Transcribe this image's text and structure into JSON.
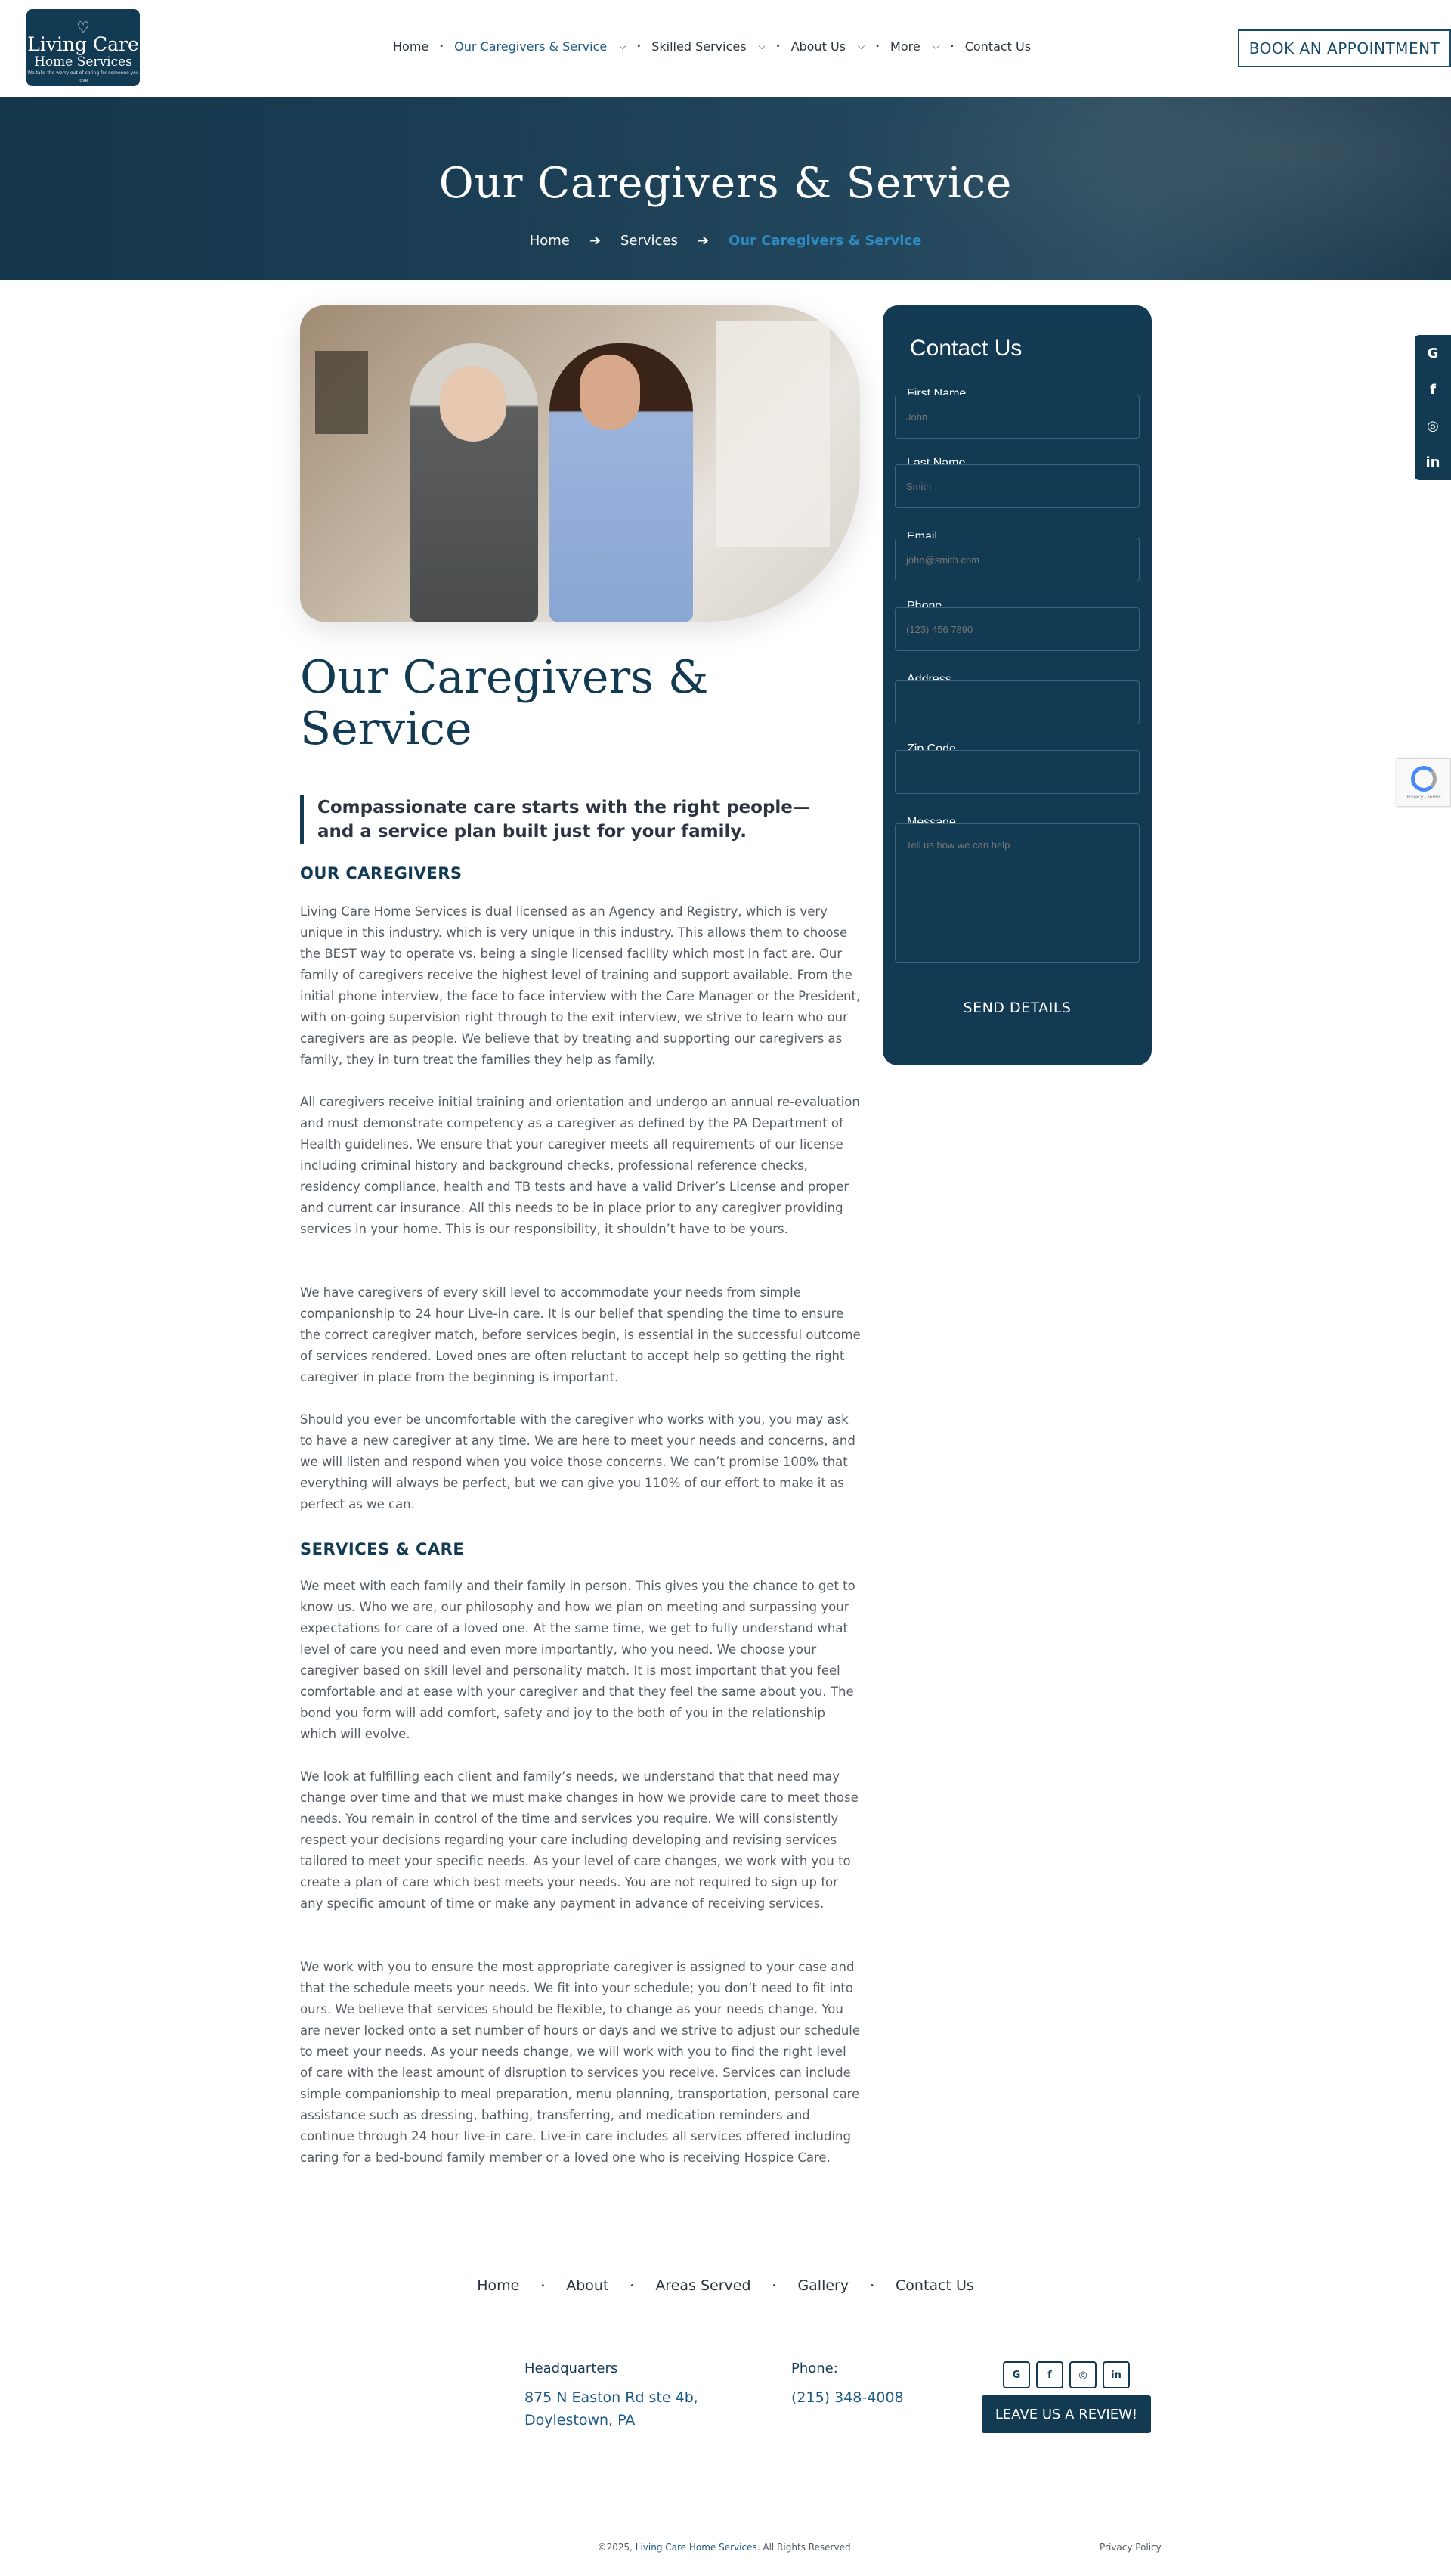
{
  "logo": {
    "line1": "Living Care",
    "line2": "Home Services",
    "tagline": "We take the worry out of caring for someone you love"
  },
  "nav": {
    "items": [
      {
        "label": "Home",
        "dropdown": false,
        "active": false
      },
      {
        "label": "Our Caregivers & Service",
        "dropdown": true,
        "active": true
      },
      {
        "label": "Skilled Services",
        "dropdown": true,
        "active": false
      },
      {
        "label": "About Us",
        "dropdown": true,
        "active": false
      },
      {
        "label": "More",
        "dropdown": true,
        "active": false
      },
      {
        "label": "Contact Us",
        "dropdown": false,
        "active": false
      }
    ],
    "book_label": "BOOK AN APPOINTMENT"
  },
  "hero": {
    "title": "Our Caregivers & Service",
    "breadcrumb": [
      "Home",
      "Services",
      "Our Caregivers & Service"
    ]
  },
  "article": {
    "title": "Our Caregivers & Service",
    "quote": "Compassionate care starts with the right people—and a service plan built just for your family.",
    "section1_heading": "OUR CAREGIVERS",
    "p1": "Living Care Home Services is dual licensed as an Agency and Registry, which is very unique in this industry. which is very unique in this industry. This allows them to choose the BEST way to operate vs. being a single licensed facility which most in fact are. Our family of caregivers receive the highest level of training and support available. From the initial phone interview, the face to face interview with the Care Manager or the President, with on-going supervision right through to the exit interview, we strive to learn who our caregivers are as people. We believe that by treating and supporting our caregivers as family, they in turn treat the families they help as family.",
    "p2": "All caregivers receive initial training and orientation and undergo an annual re-evaluation and must demonstrate competency as a caregiver as defined by the PA Department of Health guidelines. We ensure that your caregiver meets all requirements of our license including criminal history and background checks, professional reference checks, residency compliance, health and TB tests and have a valid Driver’s License and proper and current car insurance. All this needs to be in place prior to any caregiver providing services in your home. This is our responsibility, it shouldn’t have to be yours.",
    "p3": "We have caregivers of every skill level to accommodate your needs from simple companionship to 24 hour Live-in care. It is our belief that spending the time to ensure the correct caregiver match, before services begin, is essential in the successful outcome of services rendered. Loved ones are often reluctant to accept help so getting the right caregiver in place from the beginning is important.",
    "p4": "Should you ever be uncomfortable with the caregiver who works with you, you may ask to have a new caregiver at any time. We are here to meet your needs and concerns, and we will listen and respond when you voice those concerns. We can’t promise 100% that everything will always be perfect, but we can give you 110% of our effort to make it as perfect as we can.",
    "section2_heading": "SERVICES & CARE",
    "p5": "We meet with each family and their family in person. This gives you the chance to get to know us. Who we are, our philosophy and how we plan on meeting and surpassing your expectations for care of a loved one. At the same time, we get to fully understand what level of care you need and even more importantly, who you need. We choose your caregiver based on skill level and personality match. It is most important that you feel comfortable and at ease with your caregiver and that they feel the same about you. The bond you form will add comfort, safety and joy to the both of you in the relationship which will evolve.",
    "p6": "We look at fulfilling each client and family’s needs, we understand that that need may change over time and that we must make changes in how we provide care to meet those needs. You remain in control of the time and services you require. We will consistently respect your decisions regarding your care including developing and revising services tailored to meet your specific needs. As your level of care changes, we work with you to create a plan of care which best meets your needs. You are not required to sign up for any specific amount of time or make any payment in advance of receiving services.",
    "p7": "We work with you to ensure the most appropriate caregiver is assigned to your case and that the schedule meets your needs. We fit into your schedule; you don’t need to fit into ours. We believe that services should be flexible, to change as your needs change. You are never locked onto a set number of hours or days and we strive to adjust our schedule to meet your needs. As your needs change, we will work with you to find the right level of care with the least amount of disruption to services you receive. Services can include simple companionship to meal preparation, menu planning, transportation, personal care assistance such as dressing, bathing, transferring, and medication reminders and continue through 24 hour live-in care. Live-in care includes all services offered including caring for a bed-bound family member or a loved one who is receiving Hospice Care."
  },
  "form": {
    "title": "Contact Us",
    "first_name_label": "First Name",
    "first_name_placeholder": "John",
    "last_name_label": "Last Name",
    "last_name_placeholder": "Smith",
    "email_label": "Email",
    "email_placeholder": "john@smith.com",
    "phone_label": "Phone",
    "phone_placeholder": "(123) 456 7890",
    "address_label": "Address",
    "zip_label": "Zip Code",
    "message_label": "Message",
    "message_placeholder": "Tell us how we can help",
    "submit_label": "SEND DETAILS"
  },
  "side_social": [
    "G",
    "f",
    "◎",
    "in"
  ],
  "recaptcha": {
    "text": "Privacy - Terms"
  },
  "footer": {
    "nav": [
      "Home",
      "About",
      "Areas Served",
      "Gallery",
      "Contact Us"
    ],
    "hq_label": "Headquarters",
    "hq_line1": "875 N Easton Rd ste 4b,",
    "hq_line2": "Doylestown, PA",
    "phone_label": "Phone:",
    "phone_value": "(215) 348-4008",
    "social": [
      "G",
      "f",
      "◎",
      "in"
    ],
    "review_label": "LEAVE US A REVIEW!",
    "copyright_prefix": "©2025,",
    "copyright_brand": "Living Care Home Services",
    "copyright_suffix": ". All Rights Reserved.",
    "privacy_label": "Privacy Policy"
  },
  "colors": {
    "brand": "#123a52",
    "accent": "#1d5a86",
    "link_active": "#2f8ac0"
  }
}
